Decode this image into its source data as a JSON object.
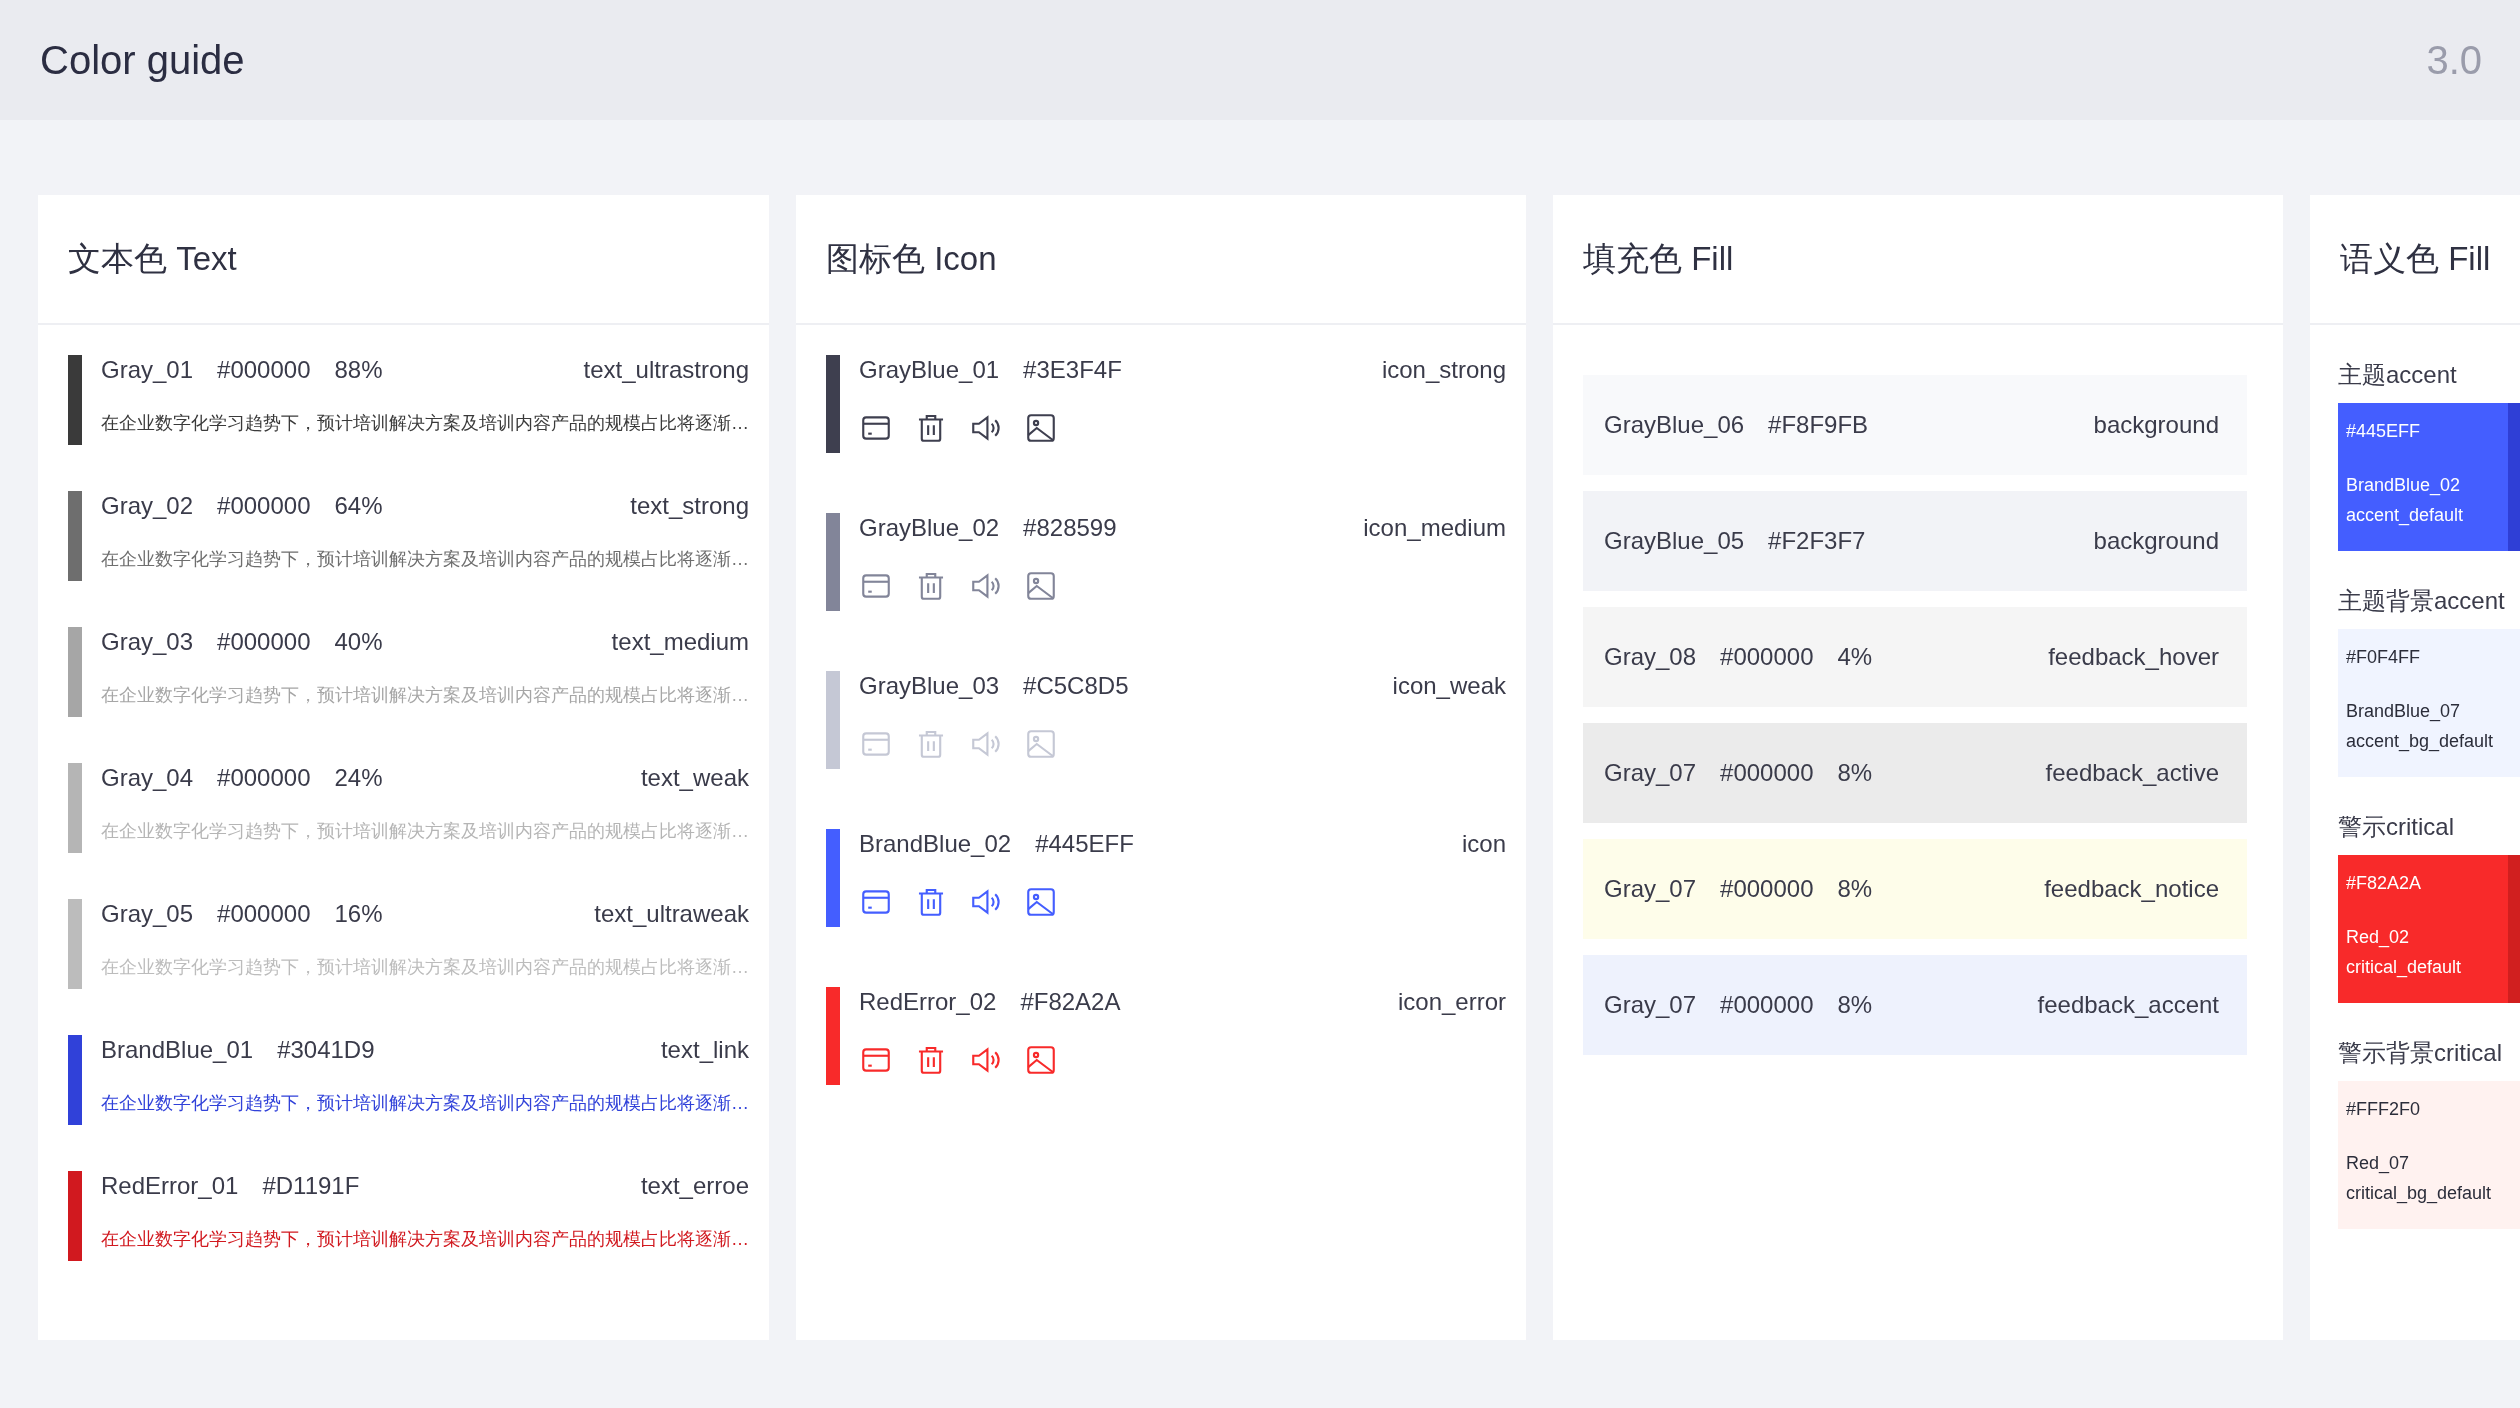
{
  "header": {
    "title": "Color guide",
    "version": "3.0"
  },
  "text_panel": {
    "title": "文本色 Text",
    "items": [
      {
        "name": "Gray_01",
        "hex": "#000000",
        "percent": "88%",
        "token": "text_ultrastrong",
        "color": "#3a3a3a",
        "sample": "在企业数字化学习趋势下，预计培训解决方案及培训内容产品的规模占比将逐渐…"
      },
      {
        "name": "Gray_02",
        "hex": "#000000",
        "percent": "64%",
        "token": "text_strong",
        "color": "#6e6e6e",
        "sample": "在企业数字化学习趋势下，预计培训解决方案及培训内容产品的规模占比将逐渐…"
      },
      {
        "name": "Gray_03",
        "hex": "#000000",
        "percent": "40%",
        "token": "text_medium",
        "color": "#a6a6a6",
        "sample": "在企业数字化学习趋势下，预计培训解决方案及培训内容产品的规模占比将逐渐…"
      },
      {
        "name": "Gray_04",
        "hex": "#000000",
        "percent": "24%",
        "token": "text_weak",
        "color": "#b5b5b5",
        "sample": "在企业数字化学习趋势下，预计培训解决方案及培训内容产品的规模占比将逐渐…"
      },
      {
        "name": "Gray_05",
        "hex": "#000000",
        "percent": "16%",
        "token": "text_ultraweak",
        "color": "#bcbcbc",
        "sample": "在企业数字化学习趋势下，预计培训解决方案及培训内容产品的规模占比将逐渐…"
      },
      {
        "name": "BrandBlue_01",
        "hex": "#3041D9",
        "token": "text_link",
        "color": "#3041d9",
        "sample": "在企业数字化学习趋势下，预计培训解决方案及培训内容产品的规模占比将逐渐…"
      },
      {
        "name": "RedError_01",
        "hex": "#D1191F",
        "token": "text_erroe",
        "color": "#d1191f",
        "sample": "在企业数字化学习趋势下，预计培训解决方案及培训内容产品的规模占比将逐渐…"
      }
    ]
  },
  "icon_panel": {
    "title": "图标色 Icon",
    "items": [
      {
        "name": "GrayBlue_01",
        "hex": "#3E3F4F",
        "token": "icon_strong",
        "color": "#3e3f4f"
      },
      {
        "name": "GrayBlue_02",
        "hex": "#828599",
        "token": "icon_medium",
        "color": "#828599"
      },
      {
        "name": "GrayBlue_03",
        "hex": "#C5C8D5",
        "token": "icon_weak",
        "color": "#c5c8d5"
      },
      {
        "name": "BrandBlue_02",
        "hex": "#445EFF",
        "token": "icon",
        "color": "#445eff"
      },
      {
        "name": "RedError_02",
        "hex": "#F82A2A",
        "token": "icon_error",
        "color": "#f82a2a"
      }
    ]
  },
  "fill_panel": {
    "title": "填充色 Fill",
    "items": [
      {
        "name": "GrayBlue_06",
        "hex": "#F8F9FB",
        "token": "background",
        "color": "#f8f9fb"
      },
      {
        "name": "GrayBlue_05",
        "hex": "#F2F3F7",
        "token": "background",
        "color": "#f2f3f7"
      },
      {
        "name": "Gray_08",
        "hex": "#000000",
        "percent": "4%",
        "token": "feedback_hover",
        "color": "#f5f5f5"
      },
      {
        "name": "Gray_07",
        "hex": "#000000",
        "percent": "8%",
        "token": "feedback_active",
        "color": "#ebebeb"
      },
      {
        "name": "Gray_07",
        "hex": "#000000",
        "percent": "8%",
        "token": "feedback_notice",
        "color": "#fefdea"
      },
      {
        "name": "Gray_07",
        "hex": "#000000",
        "percent": "8%",
        "token": "feedback_accent",
        "color": "#eef2fd"
      }
    ]
  },
  "semantic_panel": {
    "title": "语义色 Fill",
    "groups": [
      {
        "label": "主题accent",
        "hex": "#445EFF",
        "name": "BrandBlue_02",
        "token": "accent_default",
        "color": "#445eff",
        "shade": {
          "color": "#2f3fd6"
        }
      },
      {
        "label": "主题背景accent",
        "hex": "#F0F4FF",
        "name": "BrandBlue_07",
        "token": "accent_bg_default",
        "color": "#f0f4ff"
      },
      {
        "label": "警示critical",
        "hex": "#F82A2A",
        "name": "Red_02",
        "token": "critical_default",
        "color": "#f82a2a",
        "shade": {
          "color": "#d11f1f"
        }
      },
      {
        "label": "警示背景critical",
        "hex": "#FFF2F0",
        "name": "Red_07",
        "token": "critical_bg_default",
        "color": "#fff2f0"
      }
    ]
  }
}
